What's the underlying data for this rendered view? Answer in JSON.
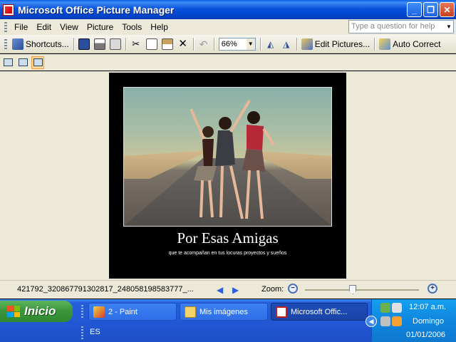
{
  "window": {
    "title": "Microsoft Office Picture Manager",
    "help_placeholder": "Type a question for help"
  },
  "menu": [
    "File",
    "Edit",
    "View",
    "Picture",
    "Tools",
    "Help"
  ],
  "toolbar": {
    "shortcuts_label": "Shortcuts...",
    "zoom_value": "66%",
    "edit_pictures_label": "Edit Pictures...",
    "auto_correct_label": "Auto Correct"
  },
  "photo": {
    "caption_title": "Por Esas Amigas",
    "caption_subtitle": "que te acompañan en tus locuras proyectos y sueños"
  },
  "status": {
    "filename": "421792_320867791302817_248058198583777_...",
    "zoom_label": "Zoom:",
    "zoom_fraction": 0.42
  },
  "taskbar": {
    "start_label": "Inicio",
    "tasks": [
      {
        "label": "2 - Paint"
      },
      {
        "label": "Mis imágenes"
      },
      {
        "label": "Microsoft Offic..."
      }
    ],
    "language": "ES",
    "time": "12:07 a.m.",
    "day": "Domingo",
    "date": "01/01/2006"
  }
}
